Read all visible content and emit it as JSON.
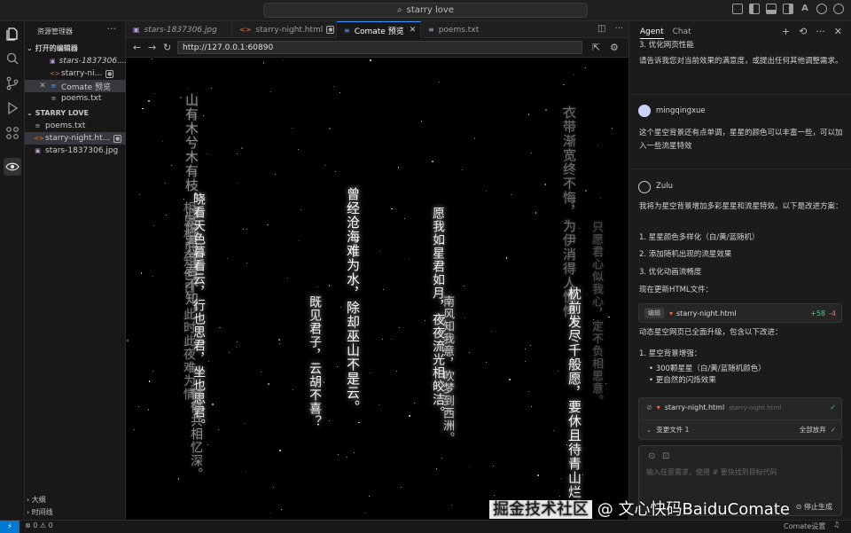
{
  "titlebar": {
    "search_text": "starry love"
  },
  "sidebar": {
    "title": "资源管理器",
    "open_editors_label": "打开的编辑器",
    "open_editors": [
      {
        "name": "stars-1837306....",
        "kind": "jpg",
        "italic": true
      },
      {
        "name": "starry-ni...",
        "kind": "html",
        "badge": "●"
      },
      {
        "name": "Comate 预览",
        "kind": "preview",
        "selected": true,
        "close": "✕"
      },
      {
        "name": "poems.txt",
        "kind": "txt"
      }
    ],
    "project_label": "STARRY LOVE",
    "project_files": [
      {
        "name": "poems.txt",
        "kind": "txt"
      },
      {
        "name": "starry-night.ht...",
        "kind": "html",
        "badge": "●",
        "selected": true
      },
      {
        "name": "stars-1837306.jpg",
        "kind": "jpg"
      }
    ],
    "outline_label": "大纲",
    "timeline_label": "时间线"
  },
  "tabs": [
    {
      "label": "stars-1837306.jpg",
      "kind": "jpg"
    },
    {
      "label": "starry-night.html",
      "kind": "html",
      "badge": "●"
    },
    {
      "label": "Comate 预览",
      "kind": "preview",
      "active": true,
      "close": "✕"
    },
    {
      "label": "poems.txt",
      "kind": "txt"
    }
  ],
  "browser": {
    "url": "http://127.0.0.1:60890"
  },
  "poems": [
    {
      "text": "山有木兮木有枝，心悦君兮君不知。",
      "color": "#8f8f8f",
      "size": 15
    },
    {
      "text": "晓看天色暮看云，行也思君，坐也思君。",
      "color": "#f2f2f2",
      "size": 14
    },
    {
      "text": "相思相见知何日，此时此夜难为情。",
      "color": "#7a7a7a",
      "size": 14
    },
    {
      "text": "郁郁共相忆深。",
      "color": "#8a8a8a",
      "size": 14
    },
    {
      "text": "既见君子，云胡不喜？",
      "color": "#f5f5f5",
      "size": 14
    },
    {
      "text": "曾经沧海难为水，除却巫山不是云。",
      "color": "#ffffff",
      "size": 15
    },
    {
      "text": "愿我如星君如月，夜夜流光相皎洁。",
      "color": "#f0f0f0",
      "size": 14
    },
    {
      "text": "南风知我意，吹梦到西洲。",
      "color": "#c8c8c8",
      "size": 13
    },
    {
      "text": "衣带渐宽终不悔，为伊消得人憔悴。",
      "color": "#6e6e6e",
      "size": 15
    },
    {
      "text": "枕前发尽千般愿，要休且待青山烂。",
      "color": "#f5f5f5",
      "size": 15
    },
    {
      "text": "只愿君心似我心，定不负相思意。",
      "color": "#4f4f4f",
      "size": 13
    }
  ],
  "agent": {
    "tabs": [
      "Agent",
      "Chat"
    ],
    "top_item": "3. 优化网页性能",
    "top_question": "请告诉我您对当前效果的满意度，或提出任何其他调整需求。",
    "user_name": "mingqingxue",
    "user_message": "这个星空背景还有点单调，星星的颜色可以丰富一些，可以加入一些流星特效",
    "bot_name": "Zulu",
    "bot_intro": "我将为星空背景增加多彩星星和流星特效。以下是改进方案：",
    "plan": [
      "1. 星星颜色多样化（白/黄/蓝随机）",
      "2. 添加随机出现的流星效果",
      "3. 优化动画流畅度"
    ],
    "update_line": "现在更新HTML文件：",
    "edit_chip": "编辑",
    "edit_file": "starry-night.html",
    "edit_add": "+58",
    "edit_del": "-4",
    "summary": "动态星空网页已全面升级，包含以下改进：",
    "upgrade_title": "1. 星空背景增强：",
    "upgrade_items": [
      "300颗星星（白/黄/蓝随机颜色）",
      "更自然的闪烁效果"
    ],
    "pending_file": "starry-night.html",
    "pending_path": "starry-night.html",
    "changed_files": "变更文件 1",
    "accept_all": "全部放弃",
    "input_placeholder": "输入任意需求，使用 # 要快找到目标代码",
    "stop_label": "停止生成"
  },
  "statusbar": {
    "remote": "⚡",
    "problems": "⊗ 0 ⚠ 0",
    "right_label": "Comate设置"
  },
  "watermark": {
    "left": "掘金技术社区",
    "right": "@ 文心快码BaiduComate"
  }
}
